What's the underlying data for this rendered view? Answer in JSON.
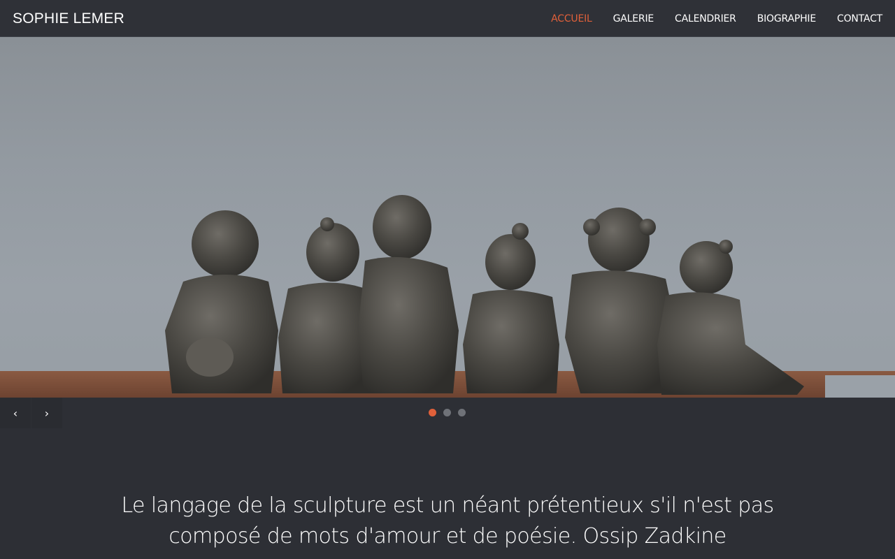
{
  "header": {
    "brand": "SOPHIE LEMER",
    "nav": [
      {
        "label": "ACCUEIL",
        "active": true
      },
      {
        "label": "GALERIE",
        "active": false
      },
      {
        "label": "CALENDRIER",
        "active": false
      },
      {
        "label": "BIOGRAPHIE",
        "active": false
      },
      {
        "label": "CONTACT",
        "active": false
      }
    ]
  },
  "carousel": {
    "prev_icon": "chevron-left-icon",
    "next_icon": "chevron-right-icon",
    "prev_glyph": "‹",
    "next_glyph": "›",
    "slide_count": 3,
    "active_slide": 1
  },
  "quote": {
    "text": "Le langage de la sculpture est un néant prétentieux s'il n'est pas composé de mots d'amour et de poésie. Ossip Zadkine"
  },
  "colors": {
    "accent": "#e0603a",
    "background": "#2d2f35",
    "header": "#2f3137"
  }
}
